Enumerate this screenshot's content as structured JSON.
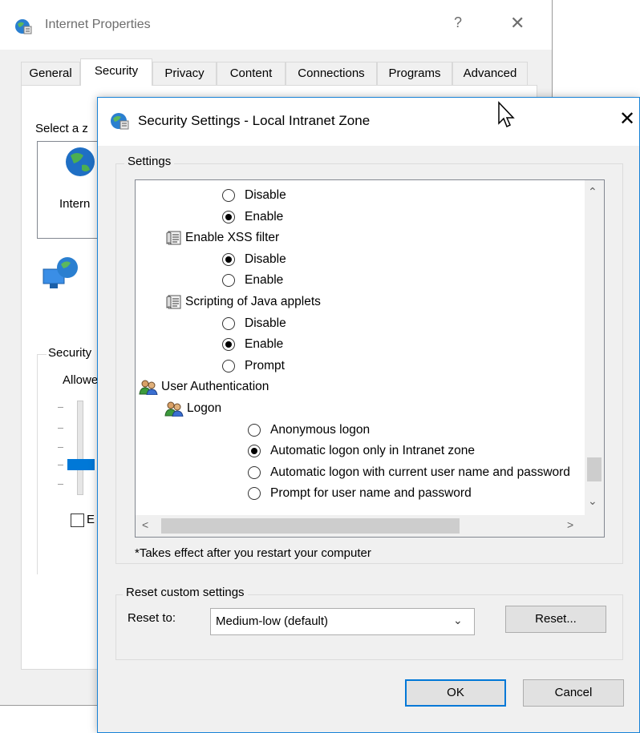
{
  "background_window": {
    "title": "Internet Properties",
    "help_glyph": "?",
    "close_glyph": "✕",
    "tabs": [
      {
        "label": "General",
        "active": false
      },
      {
        "label": "Security",
        "active": true
      },
      {
        "label": "Privacy",
        "active": false
      },
      {
        "label": "Content",
        "active": false
      },
      {
        "label": "Connections",
        "active": false
      },
      {
        "label": "Programs",
        "active": false
      },
      {
        "label": "Advanced",
        "active": false
      }
    ],
    "select_zone_label": "Select a z",
    "zone_label": "Intern",
    "security_level_label": "Security",
    "allowed_label": "Allowe",
    "checkbox_letter": "E"
  },
  "dialog": {
    "title": "Security Settings - Local Intranet Zone",
    "close_glyph": "✕",
    "settings_label": "Settings",
    "items": [
      {
        "kind": "radio",
        "text": "Disable",
        "checked": false,
        "indent": 1
      },
      {
        "kind": "radio",
        "text": "Enable",
        "checked": true,
        "indent": 1
      },
      {
        "kind": "script",
        "text": "Enable XSS filter",
        "indent": 0
      },
      {
        "kind": "radio",
        "text": "Disable",
        "checked": true,
        "indent": 1
      },
      {
        "kind": "radio",
        "text": "Enable",
        "checked": false,
        "indent": 1
      },
      {
        "kind": "script",
        "text": "Scripting of Java applets",
        "indent": 0
      },
      {
        "kind": "radio",
        "text": "Disable",
        "checked": false,
        "indent": 1
      },
      {
        "kind": "radio",
        "text": "Enable",
        "checked": true,
        "indent": 1
      },
      {
        "kind": "radio",
        "text": "Prompt",
        "checked": false,
        "indent": 1
      },
      {
        "kind": "users",
        "text": "User Authentication",
        "indent": -1
      },
      {
        "kind": "users",
        "text": "Logon",
        "indent": 0
      },
      {
        "kind": "radio",
        "text": "Anonymous logon",
        "checked": false,
        "indent": 2
      },
      {
        "kind": "radio",
        "text": "Automatic logon only in Intranet zone",
        "checked": true,
        "indent": 2
      },
      {
        "kind": "radio",
        "text": "Automatic logon with current user name and password",
        "checked": false,
        "indent": 2
      },
      {
        "kind": "radio",
        "text": "Prompt for user name and password",
        "checked": false,
        "indent": 2
      }
    ],
    "note": "*Takes effect after you restart your computer",
    "reset_group_label": "Reset custom settings",
    "reset_to_label": "Reset to:",
    "reset_select_value": "Medium-low (default)",
    "reset_button": "Reset...",
    "ok_button": "OK",
    "cancel_button": "Cancel",
    "scroll_up_glyph": "⌃",
    "scroll_down_glyph": "⌄",
    "scroll_left_glyph": "<",
    "scroll_right_glyph": ">",
    "select_chevron_glyph": "⌄"
  }
}
